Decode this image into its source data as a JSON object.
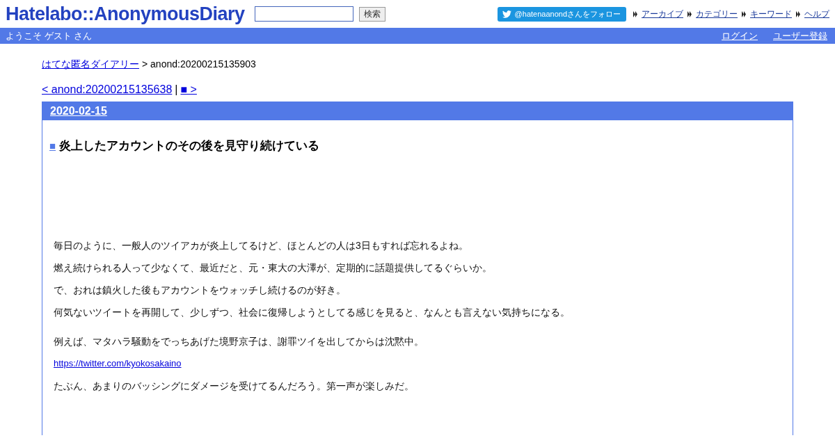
{
  "header": {
    "logo": "Hatelabo::AnonymousDiary",
    "search": {
      "button": "検索"
    },
    "follow_button": "@hatenaanondさんをフォロー",
    "links": [
      "アーカイブ",
      "カテゴリー",
      "キーワード",
      "ヘルプ"
    ]
  },
  "user_bar": {
    "welcome": "ようこそ ゲスト さん",
    "links": [
      "ログイン",
      "ユーザー登録"
    ]
  },
  "breadcrumb": {
    "link": "はてな匿名ダイアリー",
    "current": "> anond:20200215135903"
  },
  "pager": {
    "prev": "< anond:20200215135638",
    "separator": "|",
    "next": "■ >"
  },
  "day": {
    "date": "2020-02-15",
    "title_mark": "■",
    "title": "炎上したアカウントのその後を見守り続けている",
    "blocks": [
      [
        {
          "kind": "text",
          "text": "毎日のように、一般人のツイアカが炎上してるけど、ほとんどの人は3日もすれば忘れるよね。"
        },
        {
          "kind": "text",
          "text": "燃え続けられる人って少なくて、最近だと、元・東大の大澤が、定期的に話題提供してるぐらいか。"
        },
        {
          "kind": "text",
          "text": "で、おれは鎮火した後もアカウントをウォッチし続けるのが好き。"
        },
        {
          "kind": "text",
          "text": "何気ないツイートを再開して、少しずつ、社会に復帰しようとしてる感じを見ると、なんとも言えない気持ちになる。"
        }
      ],
      [
        {
          "kind": "text",
          "text": "例えば、マタハラ騒動をでっちあげた境野京子は、謝罪ツイを出してからは沈黙中。"
        },
        {
          "kind": "link",
          "text": "https://twitter.com/kyokosakaino"
        },
        {
          "kind": "text",
          "text": "たぶん、あまりのバッシングにダメージを受けてるんだろう。第一声が楽しみだ。"
        }
      ]
    ]
  }
}
